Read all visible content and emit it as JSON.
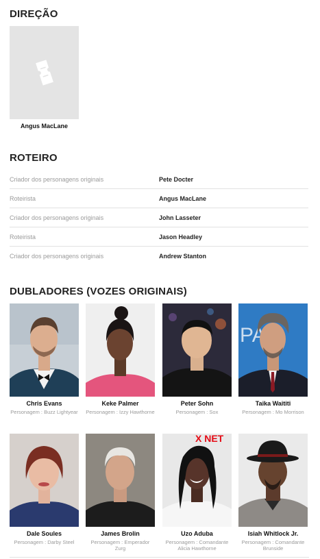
{
  "direction": {
    "title": "DIREÇÃO",
    "people": [
      {
        "name": "Angus MacLane",
        "photo_icon": "ticket-icon"
      }
    ]
  },
  "writing": {
    "title": "ROTEIRO",
    "credits": [
      {
        "role": "Criador dos personagens originais",
        "name": "Pete Docter"
      },
      {
        "role": "Roteirista",
        "name": "Angus MacLane"
      },
      {
        "role": "Criador dos personagens originais",
        "name": "John Lasseter"
      },
      {
        "role": "Roteirista",
        "name": "Jason Headley"
      },
      {
        "role": "Criador dos personagens originais",
        "name": "Andrew Stanton"
      }
    ]
  },
  "cast": {
    "title": "DUBLADORES (VOZES ORIGINAIS)",
    "members": [
      {
        "name": "Chris Evans",
        "character": "Personagem : Buzz Lightyear"
      },
      {
        "name": "Keke Palmer",
        "character": "Personagem : Izzy Hawthorne"
      },
      {
        "name": "Peter Sohn",
        "character": "Personagem : Sox"
      },
      {
        "name": "Taika Waititi",
        "character": "Personagem : Mo Morrison"
      },
      {
        "name": "Dale Soules",
        "character": "Personagem : Darby Steel"
      },
      {
        "name": "James Brolin",
        "character": "Personagem : Emperador Zurg"
      },
      {
        "name": "Uzo Aduba",
        "character": "Personagem : Comandante Alicia Hawthorne"
      },
      {
        "name": "Isiah Whitlock Jr.",
        "character": "Personagem : Comandante Brunside"
      }
    ]
  }
}
